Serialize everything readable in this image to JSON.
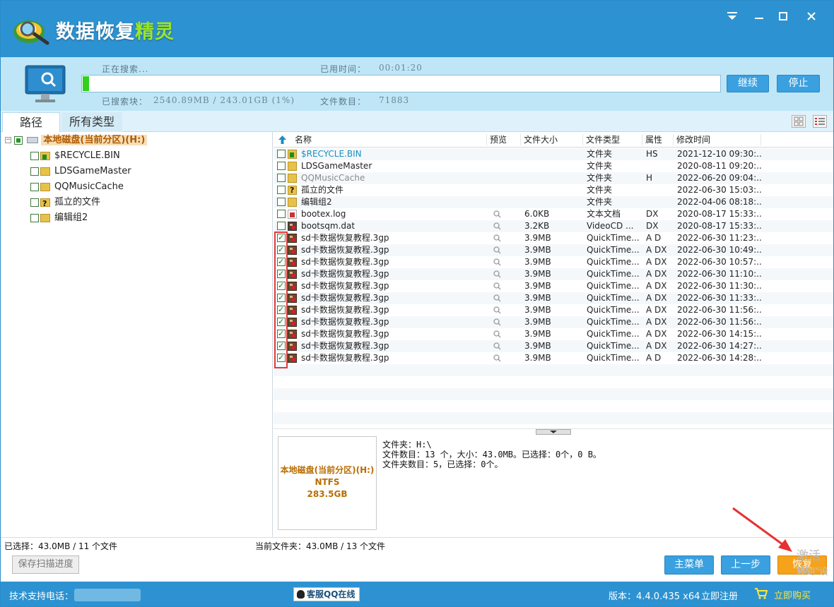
{
  "app": {
    "title_main": "数据恢复",
    "title_accent": "精灵"
  },
  "search": {
    "status_label": "正在搜索...",
    "elapsed_label": "已用时间：",
    "elapsed_value": "00:01:20",
    "blocks_label": "已搜索块：",
    "blocks_value": "2540.89MB / 243.01GB (1%)",
    "files_label": "文件数目：",
    "files_value": "71883",
    "progress_fraction": 0.01,
    "continue_label": "继续",
    "stop_label": "停止"
  },
  "tabs": [
    {
      "label": "路径"
    },
    {
      "label": "所有类型"
    }
  ],
  "tree": {
    "root": "本地磁盘(当前分区)(H:)",
    "items": [
      {
        "label": "$RECYCLE.BIN"
      },
      {
        "label": "LDSGameMaster"
      },
      {
        "label": "QQMusicCache"
      },
      {
        "label": "孤立的文件"
      },
      {
        "label": "编辑组2"
      }
    ]
  },
  "list": {
    "headers": [
      "名称",
      "预览",
      "文件大小",
      "文件类型",
      "属性",
      "修改时间"
    ],
    "rows": [
      {
        "name": "$RECYCLE.BIN",
        "size": "",
        "type": "文件夹",
        "attr": "HS",
        "time": "2021-12-10 09:30:...",
        "checked": false,
        "icon": "recycle-folder",
        "preview": false,
        "color": "#1a8fbf"
      },
      {
        "name": "LDSGameMaster",
        "size": "",
        "type": "文件夹",
        "attr": "",
        "time": "2020-08-11 09:20:...",
        "checked": false,
        "icon": "folder",
        "preview": false,
        "color": "#222222"
      },
      {
        "name": "QQMusicCache",
        "size": "",
        "type": "文件夹",
        "attr": "H",
        "time": "2022-06-20 09:04:...",
        "checked": false,
        "icon": "folder",
        "preview": false,
        "color": "#8a8a8a"
      },
      {
        "name": "孤立的文件",
        "size": "",
        "type": "文件夹",
        "attr": "",
        "time": "2022-06-30 15:03:...",
        "checked": false,
        "icon": "question-folder",
        "preview": false,
        "color": "#222222"
      },
      {
        "name": "编辑组2",
        "size": "",
        "type": "文件夹",
        "attr": "",
        "time": "2022-04-06 08:18:...",
        "checked": false,
        "icon": "folder",
        "preview": false,
        "color": "#222222"
      },
      {
        "name": "bootex.log",
        "size": "6.0KB",
        "type": "文本文档",
        "attr": "DX",
        "time": "2020-08-17 15:33:...",
        "checked": false,
        "icon": "log",
        "preview": true,
        "color": "#222222"
      },
      {
        "name": "bootsqm.dat",
        "size": "3.2KB",
        "type": "VideoCD ...",
        "attr": "DX",
        "time": "2020-08-17 15:33:...",
        "checked": false,
        "icon": "dat",
        "preview": true,
        "color": "#222222"
      },
      {
        "name": "sd卡数据恢复教程.3gp",
        "size": "3.9MB",
        "type": "QuickTime...",
        "attr": "A D",
        "time": "2022-06-30 11:23:...",
        "checked": true,
        "icon": "video",
        "preview": true,
        "color": "#222222"
      },
      {
        "name": "sd卡数据恢复教程.3gp",
        "size": "3.9MB",
        "type": "QuickTime...",
        "attr": "A DX",
        "time": "2022-06-30 10:49:...",
        "checked": true,
        "icon": "video",
        "preview": true,
        "color": "#222222"
      },
      {
        "name": "sd卡数据恢复教程.3gp",
        "size": "3.9MB",
        "type": "QuickTime...",
        "attr": "A DX",
        "time": "2022-06-30 10:57:...",
        "checked": true,
        "icon": "video",
        "preview": true,
        "color": "#222222"
      },
      {
        "name": "sd卡数据恢复教程.3gp",
        "size": "3.9MB",
        "type": "QuickTime...",
        "attr": "A DX",
        "time": "2022-06-30 11:10:...",
        "checked": true,
        "icon": "video",
        "preview": true,
        "color": "#222222"
      },
      {
        "name": "sd卡数据恢复教程.3gp",
        "size": "3.9MB",
        "type": "QuickTime...",
        "attr": "A DX",
        "time": "2022-06-30 11:30:...",
        "checked": true,
        "icon": "video",
        "preview": true,
        "color": "#222222"
      },
      {
        "name": "sd卡数据恢复教程.3gp",
        "size": "3.9MB",
        "type": "QuickTime...",
        "attr": "A DX",
        "time": "2022-06-30 11:33:...",
        "checked": true,
        "icon": "video",
        "preview": true,
        "color": "#222222"
      },
      {
        "name": "sd卡数据恢复教程.3gp",
        "size": "3.9MB",
        "type": "QuickTime...",
        "attr": "A DX",
        "time": "2022-06-30 11:56:...",
        "checked": true,
        "icon": "video",
        "preview": true,
        "color": "#222222"
      },
      {
        "name": "sd卡数据恢复教程.3gp",
        "size": "3.9MB",
        "type": "QuickTime...",
        "attr": "A DX",
        "time": "2022-06-30 11:56:...",
        "checked": true,
        "icon": "video",
        "preview": true,
        "color": "#222222"
      },
      {
        "name": "sd卡数据恢复教程.3gp",
        "size": "3.9MB",
        "type": "QuickTime...",
        "attr": "A DX",
        "time": "2022-06-30 14:15:...",
        "checked": true,
        "icon": "video",
        "preview": true,
        "color": "#222222"
      },
      {
        "name": "sd卡数据恢复教程.3gp",
        "size": "3.9MB",
        "type": "QuickTime...",
        "attr": "A DX",
        "time": "2022-06-30 14:27:...",
        "checked": true,
        "icon": "video",
        "preview": true,
        "color": "#222222"
      },
      {
        "name": "sd卡数据恢复教程.3gp",
        "size": "3.9MB",
        "type": "QuickTime...",
        "attr": "A D",
        "time": "2022-06-30 14:28:...",
        "checked": true,
        "icon": "video",
        "preview": true,
        "color": "#222222"
      }
    ]
  },
  "disk": {
    "name": "本地磁盘(当前分区)(H:)",
    "fs": "NTFS",
    "size": "283.5GB"
  },
  "info": {
    "line1": "文件夹：H:\\",
    "line2": "文件数目：13 个，大小：43.0MB。已选择：0个，0 B。",
    "line3": "文件夹数目：5，已选择：0个。"
  },
  "status": {
    "selected": "已选择：43.0MB / 11 个文件",
    "current": "当前文件夹：43.0MB / 13 个文件",
    "save_progress": "保存扫描进度"
  },
  "nav": {
    "main_menu": "主菜单",
    "prev": "上一步",
    "recover": "恢复"
  },
  "watermark": {
    "line1": "激活 W",
    "line2": "转到\"设"
  },
  "footer": {
    "support": "技术支持电话：",
    "qq": "客服QQ在线",
    "version": "版本：4.4.0.435 x64",
    "register": "立即注册",
    "buy": "立即购买"
  },
  "colors": {
    "brand_blue": "#2d92d1",
    "accent_green": "#9be62a",
    "progress_green": "#2fd11e",
    "recover_orange": "#f6a21a",
    "highlight_red": "#e03b3b"
  }
}
